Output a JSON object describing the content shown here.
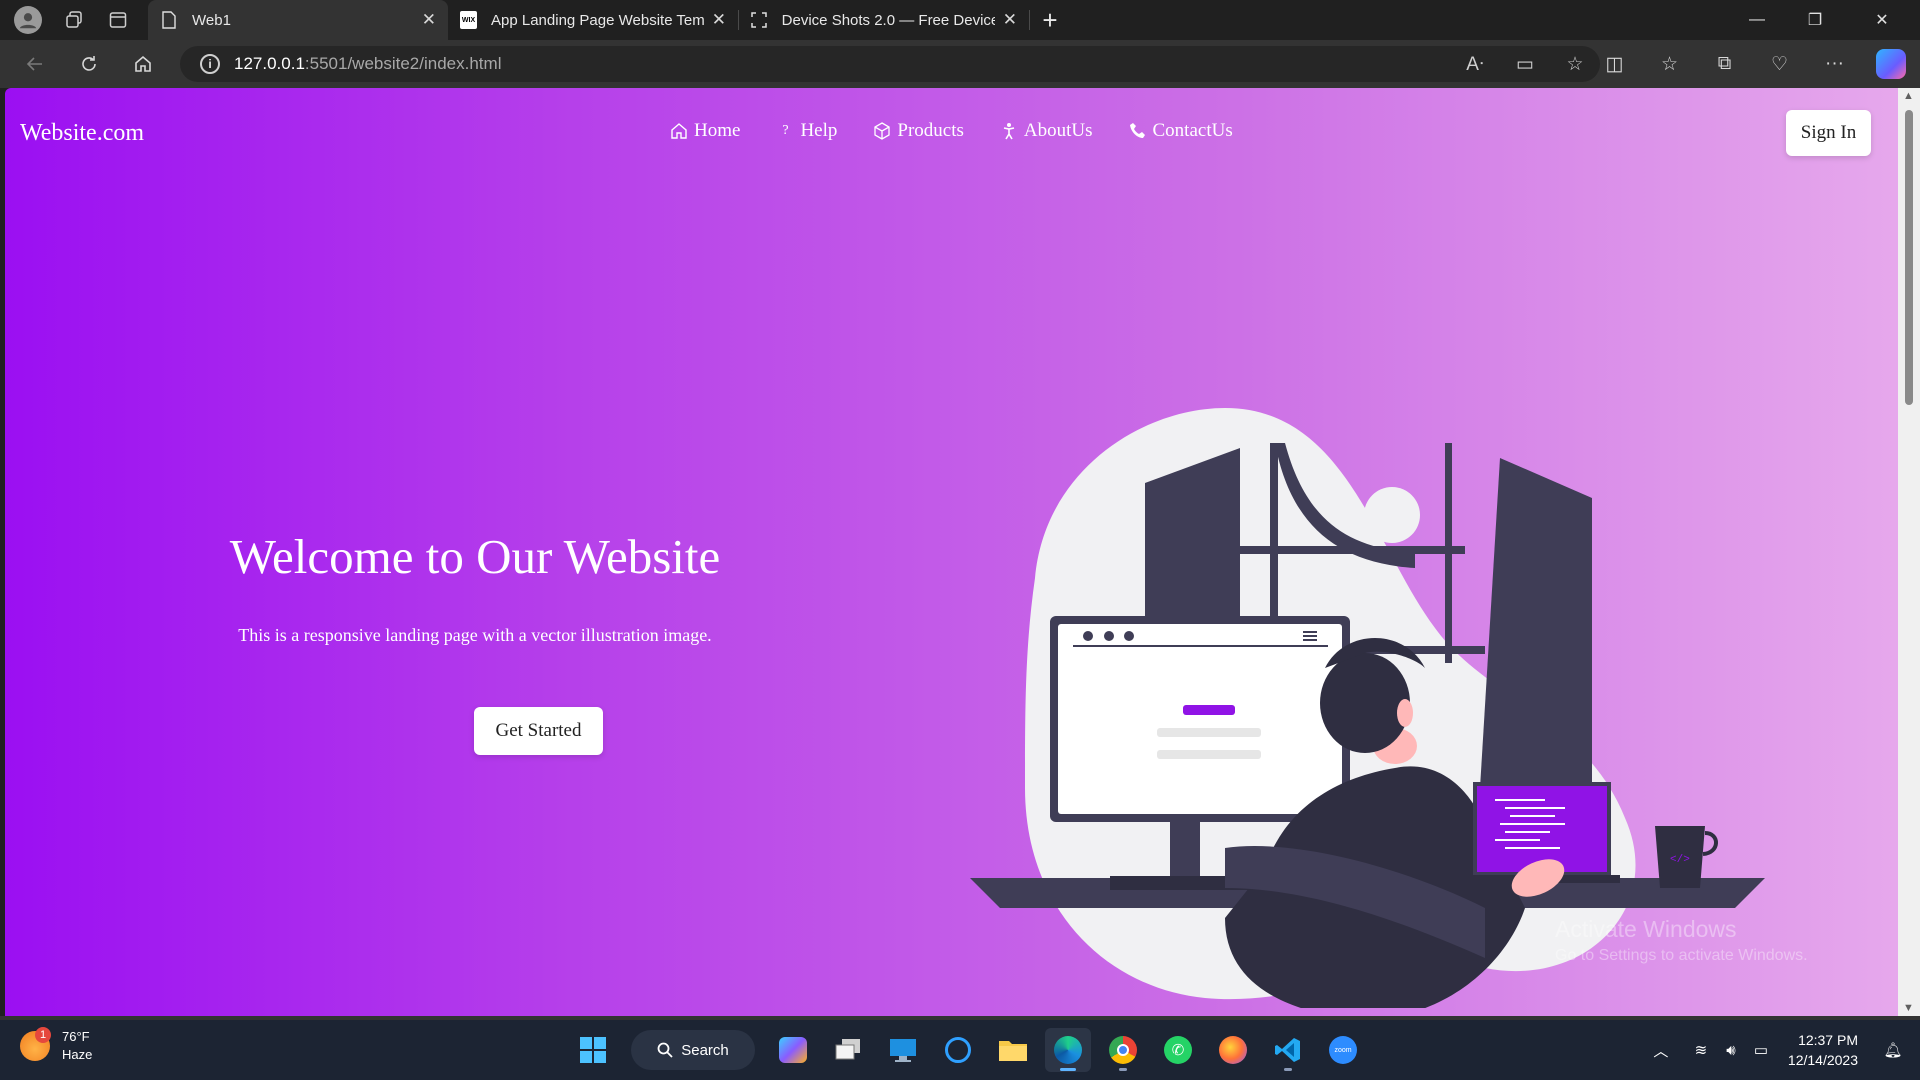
{
  "browser": {
    "tabs": [
      {
        "title": "Web1",
        "close": "✕",
        "active": true
      },
      {
        "title": "App Landing Page Website Temp",
        "close": "✕",
        "active": false,
        "favicon_text": "WIX"
      },
      {
        "title": "Device Shots 2.0 — Free Device M",
        "close": "✕",
        "active": false
      }
    ],
    "new_tab": "+",
    "window_controls": {
      "minimize": "—",
      "maximize": "❐",
      "close": "✕"
    },
    "url": {
      "host": "127.0.0.1",
      "path": ":5501/website2/index.html"
    }
  },
  "site": {
    "brand": "Website.com",
    "nav": [
      {
        "label": "Home",
        "icon": "home-icon"
      },
      {
        "label": "Help",
        "icon": "question-icon"
      },
      {
        "label": "Products",
        "icon": "box-icon"
      },
      {
        "label": "AboutUs",
        "icon": "person-icon"
      },
      {
        "label": "ContactUs",
        "icon": "phone-icon"
      }
    ],
    "signin": "Sign In",
    "hero": {
      "title": "Welcome to Our Website",
      "subtitle": "This is a responsive landing page with a vector illustration image.",
      "cta": "Get Started"
    },
    "colors": {
      "gradient_start": "#9b0ff2",
      "gradient_end": "#e6a8ec",
      "accent": "#9013e6"
    }
  },
  "watermark": {
    "line1": "Activate Windows",
    "line2": "Go to Settings to activate Windows."
  },
  "taskbar": {
    "weather": {
      "temp": "76°F",
      "condition": "Haze",
      "badge": "1"
    },
    "search_label": "Search",
    "time": "12:37 PM",
    "date": "12/14/2023"
  }
}
